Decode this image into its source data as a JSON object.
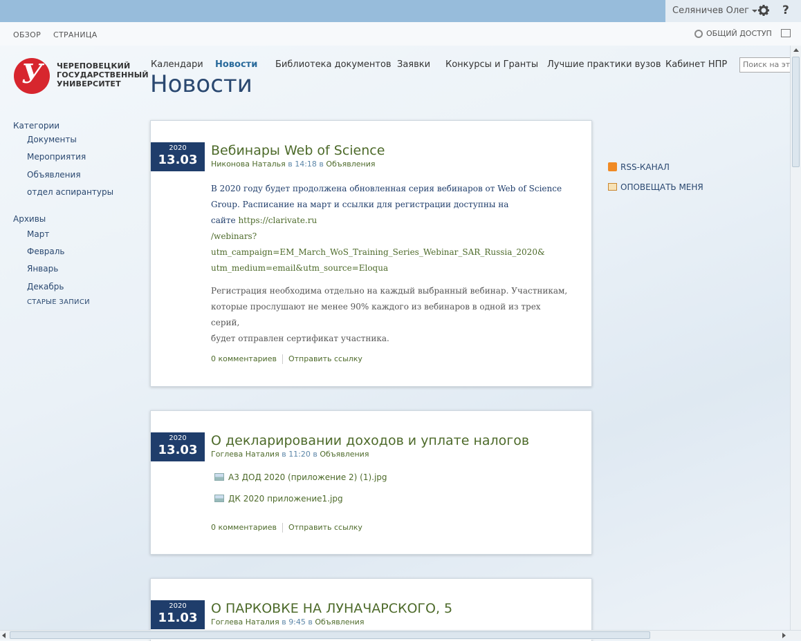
{
  "suitebar": {
    "user_name": "Селяничев Олег",
    "help_label": "?"
  },
  "ribbon": {
    "tabs": [
      "ОБЗОР",
      "СТРАНИЦА"
    ],
    "share_label": "ОБЩИЙ ДОСТУП"
  },
  "logo": {
    "mark": "У",
    "line1": "ЧЕРЕПОВЕЦКИЙ",
    "line2": "ГОСУДАРСТВЕННЫЙ",
    "line3": "УНИВЕРСИТЕТ"
  },
  "topnav": {
    "items": [
      "Календари",
      "Новости",
      "Библиотека документов",
      "Заявки",
      "Конкурсы и Гранты",
      "Лучшие практики вузов",
      "Кабинет НПР"
    ],
    "active": "Новости",
    "search_placeholder": "Поиск на это"
  },
  "page_title": "Новости",
  "leftnav": {
    "categories_heading": "Категории",
    "categories": [
      "Документы",
      "Мероприятия",
      "Объявления",
      "отдел аспирантуры"
    ],
    "archives_heading": "Архивы",
    "archives": [
      "Март",
      "Февраль",
      "Январь",
      "Декабрь"
    ],
    "old_posts": "СТАРЫЕ ЗАПИСИ"
  },
  "posts": [
    {
      "year": "2020",
      "daymonth": "13.03",
      "title": "Вебинары Web of Science",
      "author": "Никонова Наталья",
      "at": " в ",
      "time": "14:18",
      "in": " в ",
      "category": "Объявления",
      "body_p1_line1": "В 2020 году будет продолжена обновленная серия вебинаров от Web of Science",
      "body_p1_line2": "Group. Расписание на март и ссылки для регистрации доступны на",
      "body_p1_line3_prefix": "сайте ",
      "body_link_line1": "https://clarivate.ru",
      "body_link_line2": "/webinars?utm_campaign=EM_March_WoS_Training_Series_Webinar_SAR_Russia_2020&",
      "body_link_line3": "utm_medium=email&utm_source=Eloqua",
      "body_p2_line1": "Регистрация необходима отдельно на каждый выбранный вебинар. Участникам,",
      "body_p2_line2": "которые прослушают не менее 90% каждого из вебинаров в одной из трех серий,",
      "body_p2_line3": "будет отправлен сертификат участника.",
      "comments": "0 комментариев",
      "send_link": "Отправить ссылку"
    },
    {
      "year": "2020",
      "daymonth": "13.03",
      "title": "О декларировании доходов и уплате налогов",
      "author": "Гоглева Наталия",
      "at": " в ",
      "time": "11:20",
      "in": " в ",
      "category": "Объявления",
      "attachments": [
        "А3 ДОД 2020 (приложение 2) (1).jpg",
        "ДК 2020 приложение1.jpg"
      ],
      "comments": "0 комментариев",
      "send_link": "Отправить ссылку"
    },
    {
      "year": "2020",
      "daymonth": "11.03",
      "title": "О ПАРКОВКЕ НА ЛУНАЧАРСКОГО, 5",
      "author": "Гоглева Наталия",
      "at": " в ",
      "time": "9:45",
      "in": " в ",
      "category": "Объявления"
    }
  ],
  "sidebar_right": {
    "rss": "RSS-КАНАЛ",
    "notify": "ОПОВЕЩАТЬ МЕНЯ"
  },
  "colors": {
    "suitebar": "#97bcdb",
    "date_box": "#1f3d6b",
    "title_green": "#4d6a2a",
    "logo_red": "#d7262e"
  }
}
